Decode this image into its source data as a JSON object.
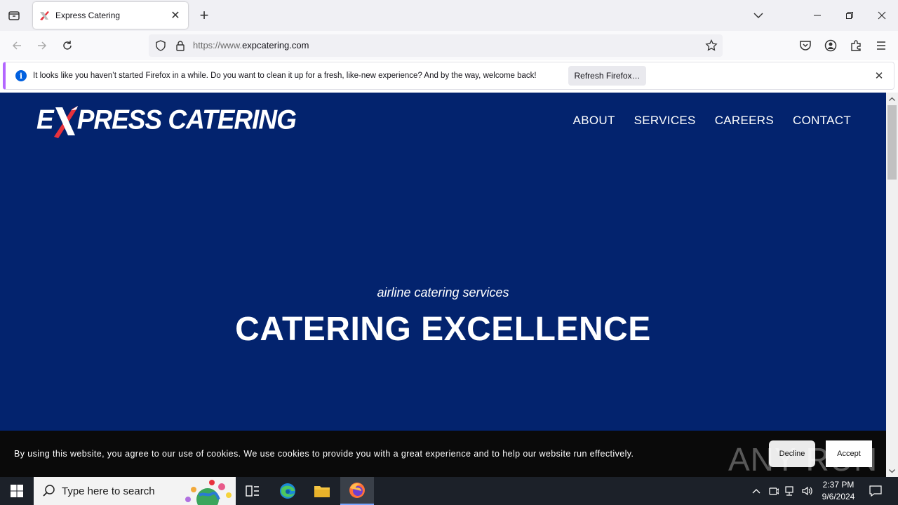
{
  "browser": {
    "tab": {
      "title": "Express Catering",
      "favicon": "express-catering-favicon"
    },
    "url": {
      "scheme": "https://www.",
      "domain": "expcatering.com"
    },
    "notification": {
      "text": "It looks like you haven’t started Firefox in a while. Do you want to clean it up for a fresh, like-new experience? And by the way, welcome back!",
      "button_label": "Refresh Firefox…"
    }
  },
  "site": {
    "logo": {
      "part1": "E",
      "part2": "PRESS CATERING"
    },
    "nav": [
      "ABOUT",
      "SERVICES",
      "CAREERS",
      "CONTACT"
    ],
    "hero": {
      "subtitle": "airline catering services",
      "title": "CATERING EXCELLENCE"
    },
    "cookie_banner": {
      "text": "By using this website, you agree to our use of cookies. We use cookies to provide you with a great experience and to help our website run effectively.",
      "decline_label": "Decline",
      "accept_label": "Accept"
    },
    "watermark": "ANY RUN",
    "colors": {
      "background": "#03236e",
      "accent": "#e8323c"
    }
  },
  "taskbar": {
    "search_placeholder": "Type here to search",
    "time": "2:37 PM",
    "date": "9/6/2024"
  }
}
